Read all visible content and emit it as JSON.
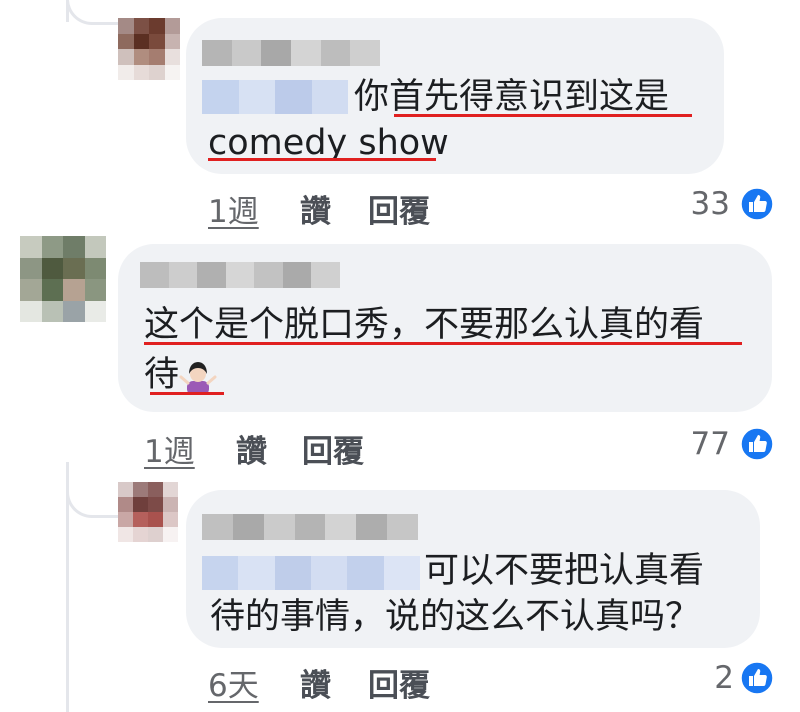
{
  "comments": [
    {
      "text_line1": "你首先得意识到这是",
      "text_line2": "comedy show",
      "time": "1週",
      "like_label": "讚",
      "reply_label": "回覆",
      "reactions": "33"
    },
    {
      "text_line1": "这个是个脱口秀，不要那么认真的看",
      "text_line2": "待",
      "emoji": "person-shrugging-emoji",
      "time": "1週",
      "like_label": "讚",
      "reply_label": "回覆",
      "reactions": "77"
    },
    {
      "text_line1": "可以不要把认真看",
      "text_line2": "待的事情，说的这么不认真吗？",
      "time": "6天",
      "like_label": "讚",
      "reply_label": "回覆",
      "reactions": "2"
    }
  ],
  "colors": {
    "bubble": "#f0f2f5",
    "underline": "#e02020",
    "like_blue": "#1877f2",
    "meta_text": "#65676b"
  },
  "icons": [
    "like-thumb-icon",
    "person-shrugging-emoji"
  ]
}
